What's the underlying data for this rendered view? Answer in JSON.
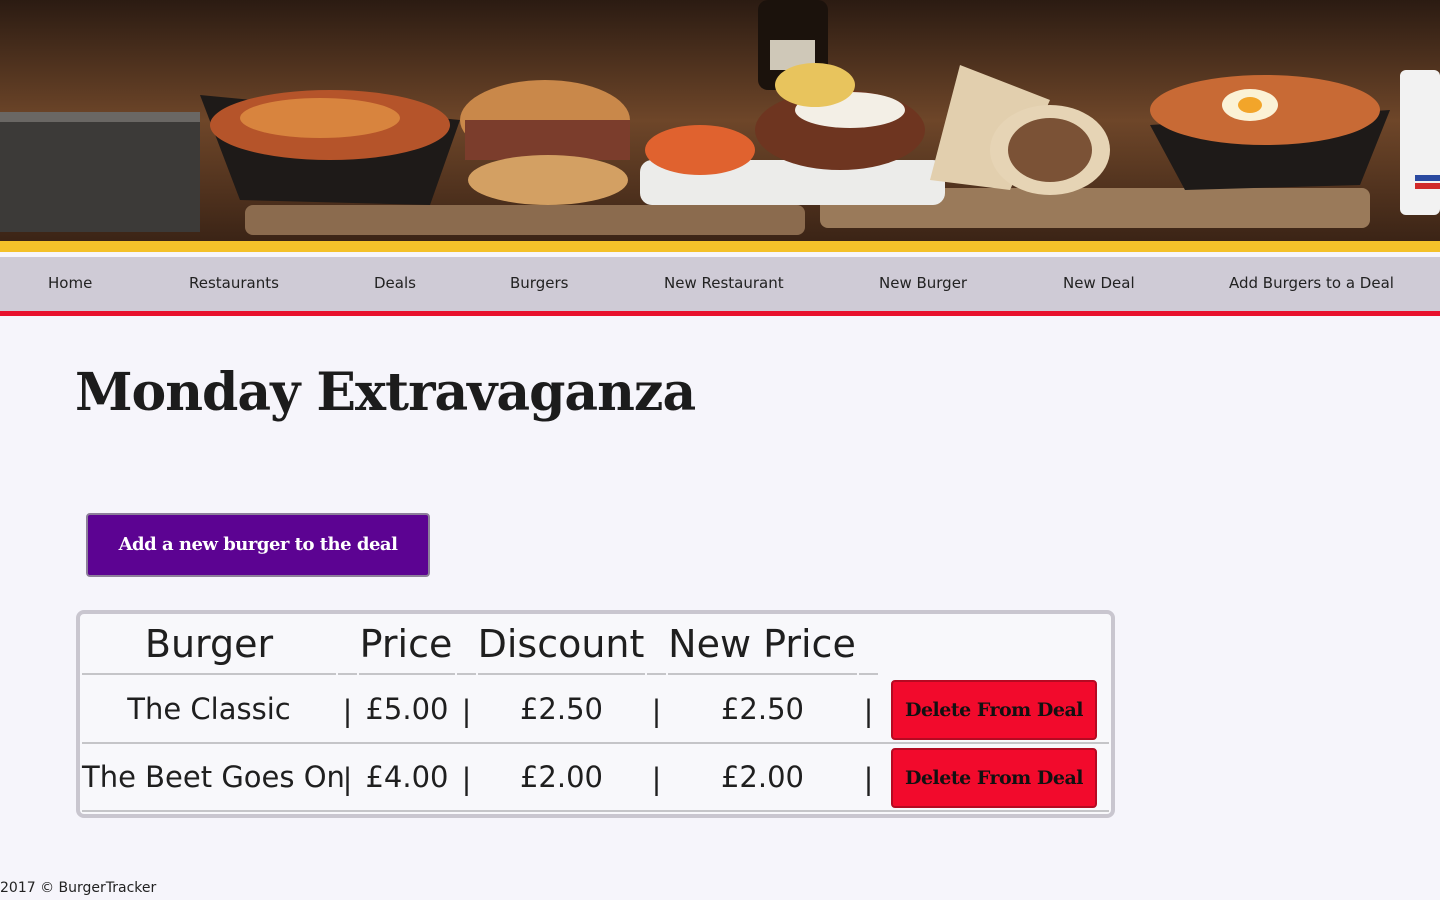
{
  "nav": {
    "items": [
      {
        "label": "Home"
      },
      {
        "label": "Restaurants"
      },
      {
        "label": "Deals"
      },
      {
        "label": "Burgers"
      },
      {
        "label": "New Restaurant"
      },
      {
        "label": "New Burger"
      },
      {
        "label": "New Deal"
      },
      {
        "label": "Add Burgers to a Deal"
      }
    ]
  },
  "page": {
    "title": "Monday Extravaganza",
    "add_button_label": "Add a new burger to the deal"
  },
  "table": {
    "headers": [
      "Burger",
      "Price",
      "Discount",
      "New Price"
    ],
    "separator": "|",
    "rows": [
      {
        "burger": "The Classic",
        "price": "£5.00",
        "discount": "£2.50",
        "new_price": "£2.50",
        "action_label": "Delete From Deal"
      },
      {
        "burger": "The Beet Goes On",
        "price": "£4.00",
        "discount": "£2.00",
        "new_price": "£2.00",
        "action_label": "Delete From Deal"
      }
    ]
  },
  "footer": {
    "text": "2017 © BurgerTracker"
  },
  "colors": {
    "nav_background": "#cfcbd6",
    "nav_underline": "#e8112d",
    "hero_stripe": "#f4c12a",
    "add_button": "#5c0392",
    "delete_button": "#f20a2c",
    "page_background": "#f6f5fb"
  }
}
